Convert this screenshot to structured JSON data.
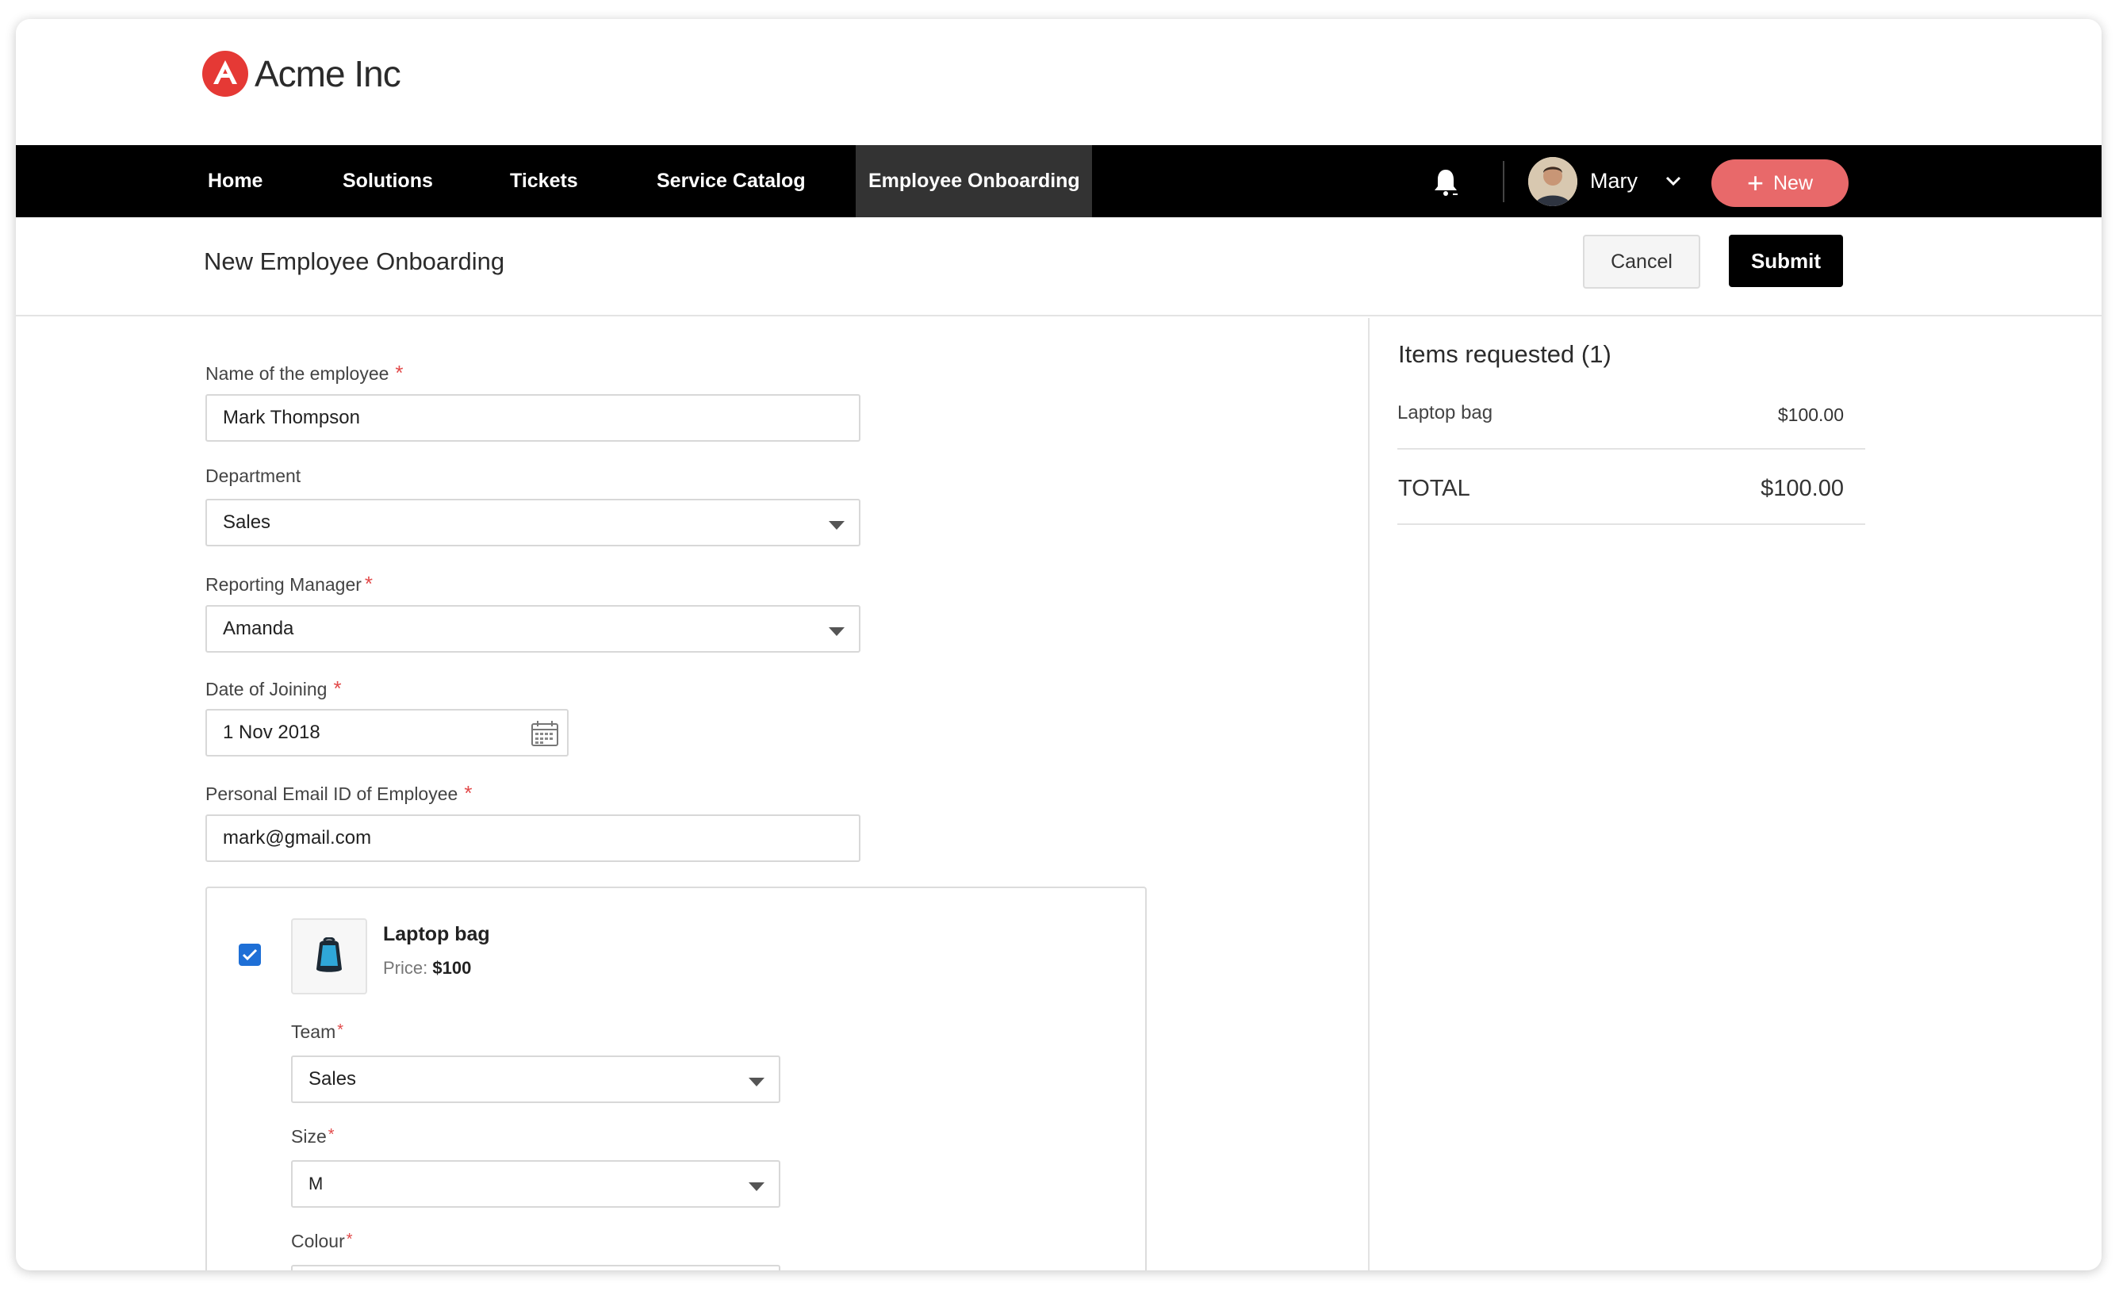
{
  "brand": {
    "name": "Acme Inc",
    "accent": "#e53935"
  },
  "nav": {
    "items": [
      {
        "label": "Home"
      },
      {
        "label": "Solutions"
      },
      {
        "label": "Tickets"
      },
      {
        "label": "Service Catalog"
      },
      {
        "label": "Employee Onboarding",
        "active": true
      }
    ],
    "user_name": "Mary",
    "new_label": "New",
    "new_color": "#e8696a"
  },
  "page": {
    "title": "New Employee Onboarding",
    "cancel_label": "Cancel",
    "submit_label": "Submit"
  },
  "form": {
    "employee_name": {
      "label": "Name of the employee",
      "required": true,
      "value": "Mark Thompson"
    },
    "department": {
      "label": "Department",
      "required": false,
      "value": "Sales"
    },
    "reporting_manager": {
      "label": "Reporting Manager",
      "required": true,
      "value": "Amanda"
    },
    "date_of_joining": {
      "label": "Date of Joining",
      "required": true,
      "value": "1 Nov 2018"
    },
    "personal_email": {
      "label": "Personal Email ID of Employee",
      "required": true,
      "value": "mark@gmail.com"
    }
  },
  "catalog_item": {
    "checked": true,
    "name": "Laptop bag",
    "price_label": "Price:",
    "price": "$100",
    "fields": {
      "team": {
        "label": "Team",
        "value": "Sales"
      },
      "size": {
        "label": "Size",
        "value": "M"
      },
      "colour": {
        "label": "Colour",
        "value": ""
      }
    }
  },
  "summary": {
    "title": "Items requested (1)",
    "lines": [
      {
        "name": "Laptop bag",
        "price": "$100.00"
      }
    ],
    "total_label": "TOTAL",
    "total_value": "$100.00"
  },
  "icons": {
    "logo": "acme-logo-icon",
    "bell": "bell-icon",
    "chevron": "chevron-down-icon",
    "plus": "plus-icon",
    "calendar": "calendar-icon",
    "dropdown": "dropdown-caret-icon",
    "checkbox": "checkbox-checked-icon",
    "product": "backpack-icon"
  }
}
